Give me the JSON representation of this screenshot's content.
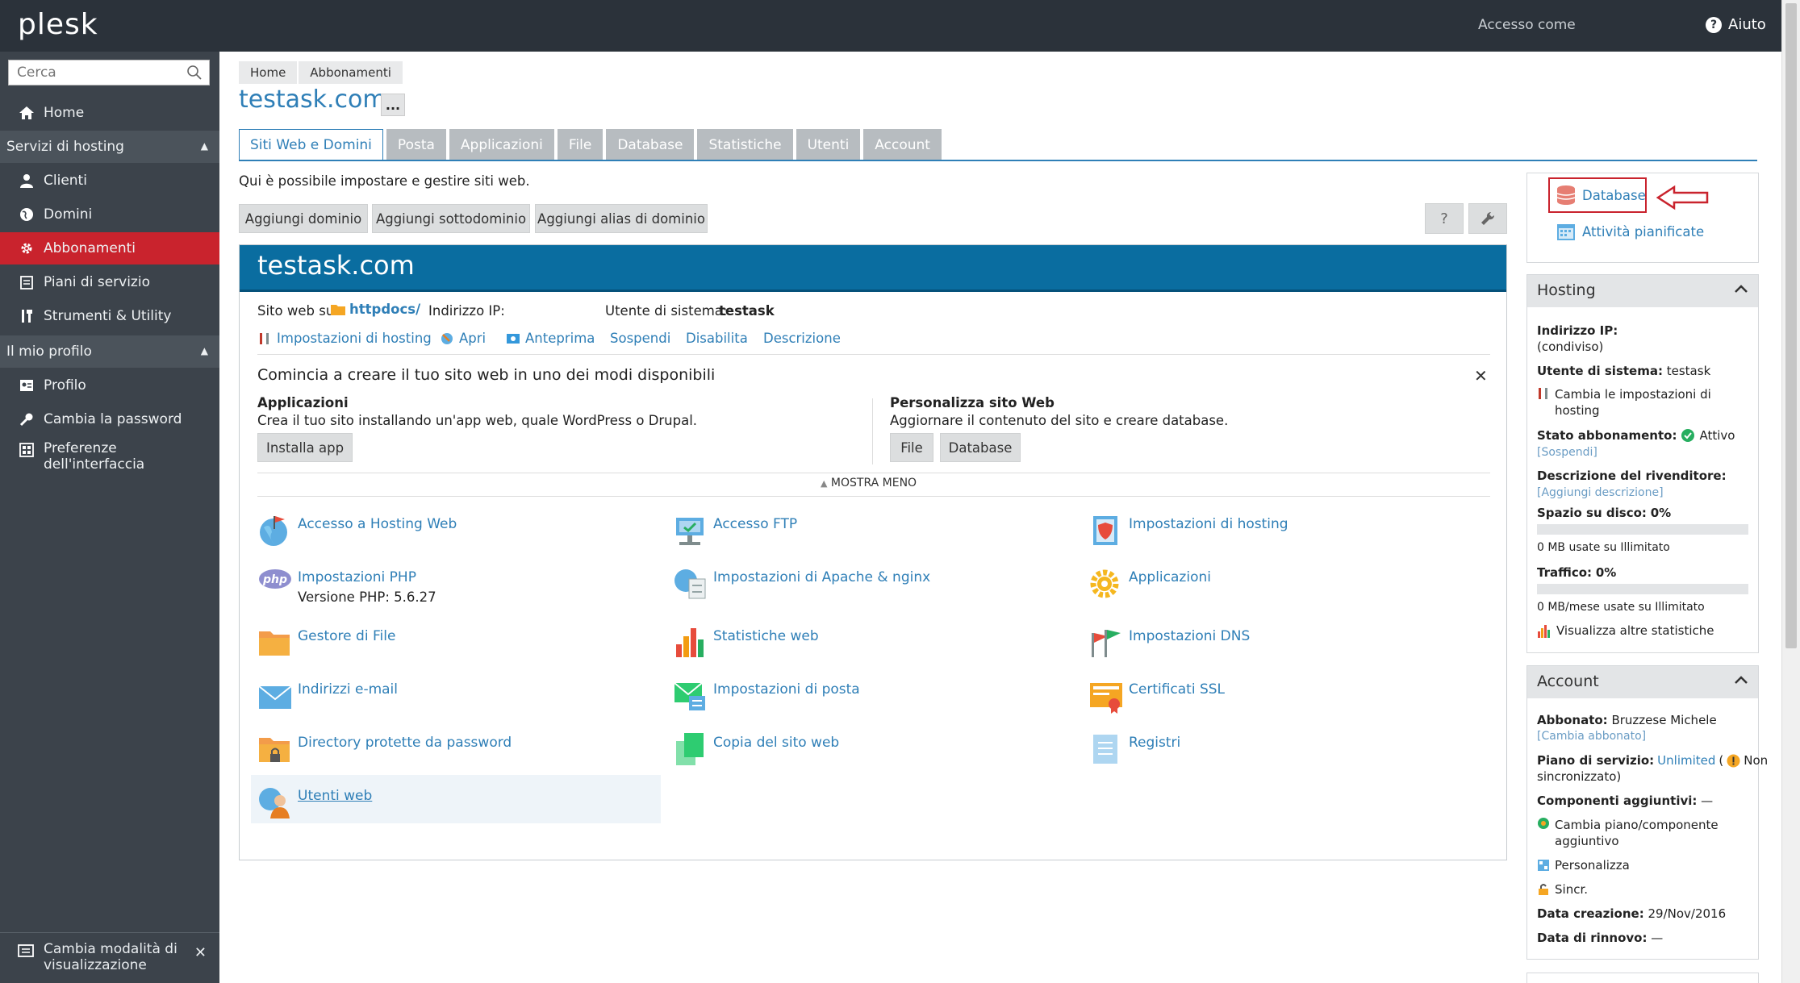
{
  "topbar": {
    "logo": "plesk",
    "access_label": "Accesso come",
    "help_label": "Aiuto"
  },
  "sidebar": {
    "search_placeholder": "Cerca",
    "home": "Home",
    "section_hosting": "Servizi di hosting",
    "clienti": "Clienti",
    "domini": "Domini",
    "abbonamenti": "Abbonamenti",
    "piani": "Piani di servizio",
    "strumenti": "Strumenti & Utility",
    "section_profile": "Il mio profilo",
    "profilo": "Profilo",
    "password": "Cambia la password",
    "preferenze_1": "Preferenze",
    "preferenze_2": "dell'interfaccia",
    "view_mode_1": "Cambia modalità di",
    "view_mode_2": "visualizzazione"
  },
  "breadcrumb": {
    "home": "Home",
    "abbonamenti": "Abbonamenti"
  },
  "page_title": "testask.com",
  "more_label": "...",
  "tabs": [
    "Siti Web e Domini",
    "Posta",
    "Applicazioni",
    "File",
    "Database",
    "Statistiche",
    "Utenti",
    "Account"
  ],
  "intro_text": "Qui è possibile impostare e gestire siti web.",
  "buttons": {
    "add_domain": "Aggiungi dominio",
    "add_subdomain": "Aggiungi sottodominio",
    "add_alias": "Aggiungi alias di dominio",
    "help": "?"
  },
  "domain": {
    "name": "testask.com",
    "site_label": "Sito web su",
    "site_folder": "httpdocs/",
    "ip_label": "Indirizzo IP:",
    "user_label": "Utente di sistema:",
    "user_value": "testask",
    "actions": [
      "Impostazioni di hosting",
      "Apri",
      "Anteprima",
      "Sospendi",
      "Disabilita",
      "Descrizione"
    ],
    "start_title": "Comincia a creare il tuo sito web in uno dei modi disponibili",
    "apps_title": "Applicazioni",
    "apps_desc": "Crea il tuo sito installando un'app web, quale WordPress o Drupal.",
    "install_app": "Installa app",
    "custom_title": "Personalizza sito Web",
    "custom_desc": "Aggiornare il contenuto del sito e creare database.",
    "file_btn": "File",
    "db_btn": "Database",
    "show_less": "MOSTRA MENO",
    "items": {
      "hosting_web": "Accesso a Hosting Web",
      "ftp": "Accesso FTP",
      "hosting_settings": "Impostazioni di hosting",
      "php": "Impostazioni PHP",
      "php_version": "Versione PHP: 5.6.27",
      "apache": "Impostazioni di Apache & nginx",
      "applicazioni": "Applicazioni",
      "file_manager": "Gestore di File",
      "web_stats": "Statistiche web",
      "dns": "Impostazioni DNS",
      "email": "Indirizzi e-mail",
      "mail_settings": "Impostazioni di posta",
      "ssl": "Certificati SSL",
      "protected_dirs": "Directory protette da password",
      "backup": "Copia del sito web",
      "logs": "Registri",
      "web_users": "Utenti web"
    }
  },
  "right": {
    "database_link": "Database",
    "scheduled_tasks": "Attività pianificate",
    "hosting": {
      "title": "Hosting",
      "ip_label": "Indirizzo IP:",
      "ip_note": "(condiviso)",
      "user_label": "Utente di sistema:",
      "user_value": "testask",
      "change_1": "Cambia le impostazioni di",
      "change_2": "hosting",
      "status_label": "Stato abbonamento:",
      "status_value": "Attivo",
      "suspend": "[Sospendi]",
      "reseller_label": "Descrizione del rivenditore:",
      "add_desc": "[Aggiungi descrizione]",
      "disk_label": "Spazio su disco:",
      "disk_value": "0%",
      "disk_percent": 0,
      "disk_note": "0 MB usate su Illimitato",
      "traffic_label": "Traffico:",
      "traffic_value": "0%",
      "traffic_percent": 0,
      "traffic_note": "0 MB/mese usate su Illimitato",
      "more_stats": "Visualizza altre statistiche"
    },
    "account": {
      "title": "Account",
      "subscriber_label": "Abbonato:",
      "subscriber_value": "Bruzzese Michele",
      "change_subscriber": "[Cambia abbonato]",
      "plan_label": "Piano di servizio:",
      "plan_value": "Unlimited",
      "plan_note_1": "Non",
      "plan_note_2": "sincronizzato)",
      "addons_label": "Componenti aggiuntivi:",
      "addons_value": "—",
      "change_plan_1": "Cambia piano/componente",
      "change_plan_2": "aggiuntivo",
      "customize": "Personalizza",
      "sync": "Sincr.",
      "created_label": "Data creazione:",
      "created_value": "29/Nov/2016",
      "renewal_label": "Data di rinnovo:",
      "renewal_value": "—"
    }
  }
}
